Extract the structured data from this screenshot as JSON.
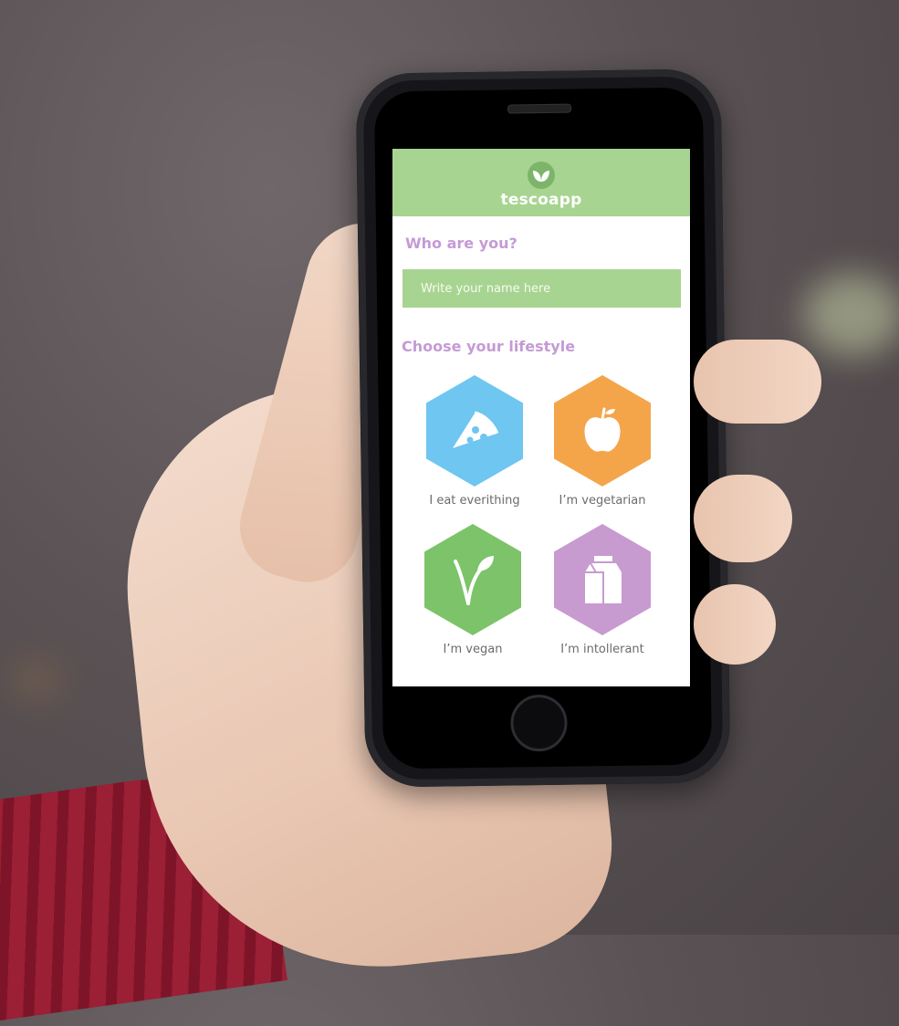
{
  "app": {
    "name": "tescoapp",
    "header_color": "#a8d491",
    "accent_color": "#c59ad6"
  },
  "profile": {
    "title": "Who are you?",
    "name_placeholder": "Write your name here",
    "name_value": ""
  },
  "lifestyle": {
    "title": "Choose your lifestyle",
    "options": [
      {
        "label": "I eat everithing",
        "icon": "pizza-icon",
        "color": "#6ec6f1"
      },
      {
        "label": "I’m vegetarian",
        "icon": "apple-icon",
        "color": "#f4a54a"
      },
      {
        "label": "I’m vegan",
        "icon": "leaf-icon",
        "color": "#7cc36a"
      },
      {
        "label": "I’m intollerant",
        "icon": "milk-carton-icon",
        "color": "#c79ad0"
      }
    ]
  }
}
